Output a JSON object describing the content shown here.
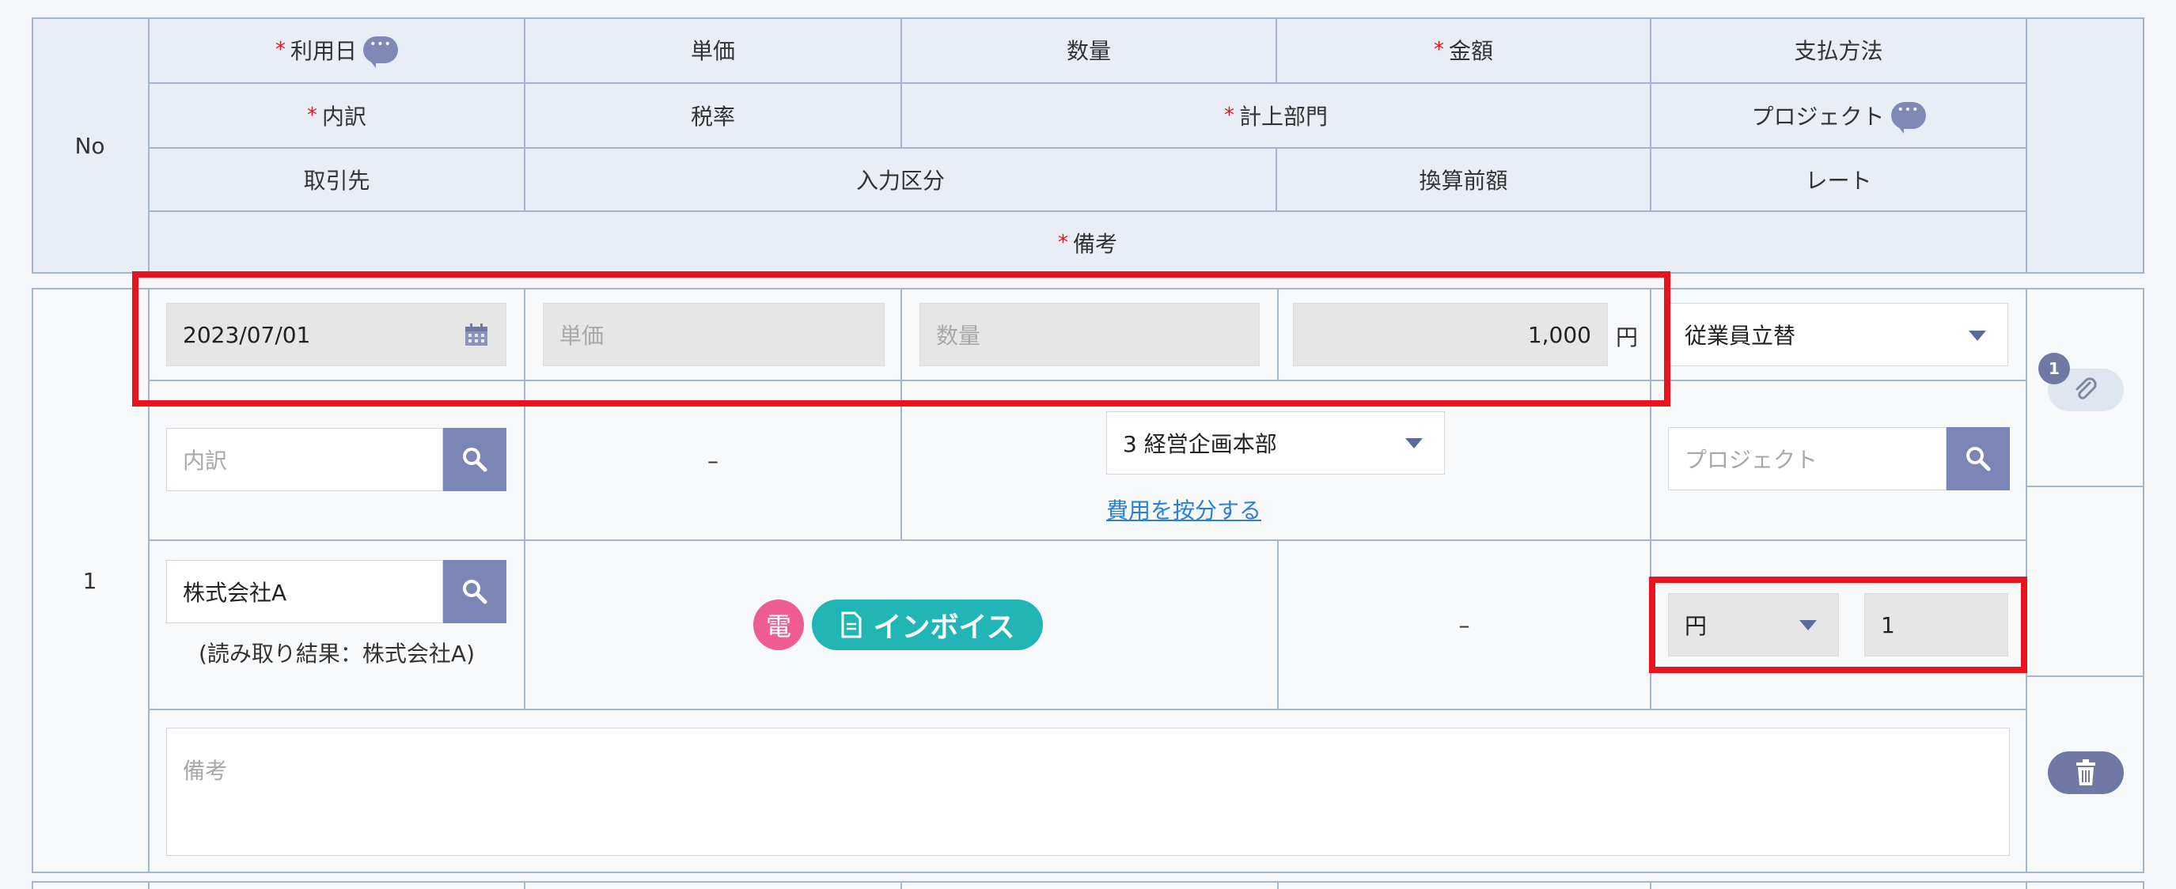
{
  "header": {
    "no": "No",
    "row1": {
      "date": "利用日",
      "unit_price": "単価",
      "quantity": "数量",
      "amount": "金額",
      "payment": "支払方法"
    },
    "row2": {
      "breakdown": "内訳",
      "tax_rate": "税率",
      "department": "計上部門",
      "project": "プロジェクト"
    },
    "row3": {
      "vendor": "取引先",
      "input_type": "入力区分",
      "pre_conversion": "換算前額",
      "rate": "レート"
    },
    "row4": {
      "remarks": "備考"
    },
    "required_mark": "*"
  },
  "entry": {
    "number": "1",
    "date_value": "2023/07/01",
    "unit_price_placeholder": "単価",
    "quantity_placeholder": "数量",
    "amount_value": "1,000",
    "amount_unit": "円",
    "payment_value": "従業員立替",
    "breakdown_placeholder": "内訳",
    "tax_rate_value": "–",
    "department_value": "3 経営企画本部",
    "allocate_link": "費用を按分する",
    "project_placeholder": "プロジェクト",
    "vendor_value": "株式会社A",
    "vendor_read_result": "(読み取り結果：株式会社A)",
    "e_badge": "電",
    "invoice_badge": "インボイス",
    "pre_conversion_value": "–",
    "currency_value": "円",
    "rate_value": "1",
    "remarks_placeholder": "備考",
    "attachment_count": "1"
  },
  "colors": {
    "header_bg": "#e9eef6",
    "border": "#a7b4cd",
    "highlight": "#e8131e",
    "accent_button": "#7a86b6",
    "invoice_badge": "#22b5b5",
    "e_badge": "#ee5c93",
    "link": "#2a80d8"
  }
}
